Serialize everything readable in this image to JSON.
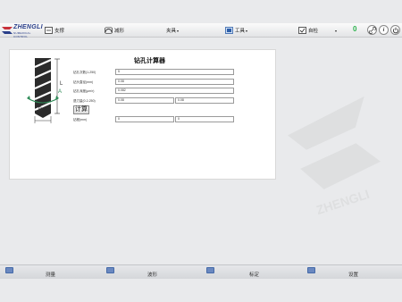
{
  "app": {
    "brand": "ZHENGLI",
    "brand_sub": "NUMERICAL CONTROL"
  },
  "toolbar": {
    "support": "支撑",
    "mould": "减形",
    "fixture": "夹具",
    "tools": "工具",
    "autocheck": "自检",
    "counter": "0"
  },
  "calculator": {
    "title": "钻孔计算器",
    "fields": [
      {
        "label": "钻孔次数(1-250)",
        "value": "5"
      },
      {
        "label": "钻头直径(mm)",
        "value": "0.08"
      },
      {
        "label": "钻孔深度(µm/r)",
        "value": "0.082"
      }
    ],
    "retract_label": "退刀量(0.2-250)",
    "retract_values": [
      "0.08",
      "0.08"
    ],
    "calc_button": "计算",
    "result_label": "钻程(mm)",
    "result_values": [
      "0",
      "0"
    ],
    "diagram_labels": {
      "L": "L",
      "A": "A",
      "B": "B"
    }
  },
  "bottom_nav": [
    {
      "label": "测量",
      "icon": "measure-icon"
    },
    {
      "label": "波形",
      "icon": "waveform-icon"
    },
    {
      "label": "标定",
      "icon": "calibrate-icon"
    },
    {
      "label": "设置",
      "icon": "settings-icon"
    }
  ]
}
